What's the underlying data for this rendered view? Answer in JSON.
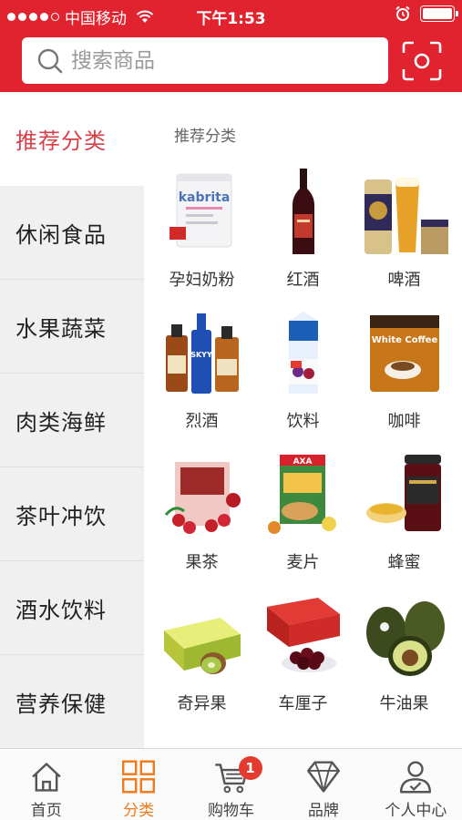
{
  "status_bar": {
    "carrier": "中国移动",
    "time": "下午1:53",
    "signal_icon": "signal-dots-icon",
    "wifi_icon": "wifi-icon",
    "alarm_icon": "alarm-icon",
    "battery_icon": "battery-icon",
    "battery_level": 1.0
  },
  "search": {
    "placeholder": "搜索商品",
    "icon": "search-icon",
    "scan_icon": "scan-icon"
  },
  "colors": {
    "brand_red": "#e0232f",
    "active_side_text": "#d6414a",
    "active_tab": "#ef7a1c",
    "badge": "#e33b2f"
  },
  "sidebar": {
    "items": [
      {
        "label": "推荐分类"
      },
      {
        "label": "休闲食品"
      },
      {
        "label": "水果蔬菜"
      },
      {
        "label": "肉类海鲜"
      },
      {
        "label": "茶叶冲饮"
      },
      {
        "label": "酒水饮料"
      },
      {
        "label": "营养保健"
      }
    ],
    "active_index": 0
  },
  "content": {
    "section_title": "推荐分类",
    "categories": [
      {
        "label": "孕妇奶粉",
        "image": "formula-can-image",
        "brand_text": "kabrita"
      },
      {
        "label": "红酒",
        "image": "red-wine-bottle-image"
      },
      {
        "label": "啤酒",
        "image": "beer-image"
      },
      {
        "label": "烈酒",
        "image": "spirits-bottles-image",
        "brand_text": "SKYY"
      },
      {
        "label": "饮料",
        "image": "juice-carton-image"
      },
      {
        "label": "咖啡",
        "image": "coffee-bag-image",
        "brand_text": "White Coffee"
      },
      {
        "label": "果茶",
        "image": "fruit-tea-box-image"
      },
      {
        "label": "麦片",
        "image": "cereal-box-image",
        "brand_text": "AXA"
      },
      {
        "label": "蜂蜜",
        "image": "honey-jar-image"
      },
      {
        "label": "奇异果",
        "image": "kiwi-box-image"
      },
      {
        "label": "车厘子",
        "image": "cherries-image"
      },
      {
        "label": "牛油果",
        "image": "avocado-image"
      }
    ]
  },
  "tabbar": {
    "tabs": [
      {
        "label": "首页",
        "icon": "home-icon"
      },
      {
        "label": "分类",
        "icon": "category-grid-icon"
      },
      {
        "label": "购物车",
        "icon": "cart-icon",
        "badge": "1"
      },
      {
        "label": "品牌",
        "icon": "diamond-icon"
      },
      {
        "label": "个人中心",
        "icon": "user-icon"
      }
    ],
    "active_index": 1
  }
}
